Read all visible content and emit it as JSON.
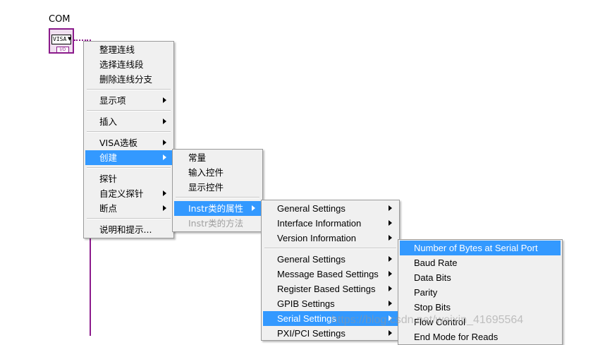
{
  "terminal": {
    "label": "COM",
    "control_text": "VISA",
    "io_text": "I/O"
  },
  "menu1": {
    "items": [
      "整理连线",
      "选择连线段",
      "删除连线分支",
      "显示项",
      "插入",
      "VISA选板",
      "创建",
      "探针",
      "自定义探针",
      "断点",
      "说明和提示..."
    ]
  },
  "menu2": {
    "items": [
      "常量",
      "输入控件",
      "显示控件",
      "Instr类的属性",
      "Instr类的方法"
    ]
  },
  "menu3": {
    "items": [
      "General Settings",
      "Interface Information",
      "Version Information",
      "General Settings",
      "Message Based Settings",
      "Register Based Settings",
      "GPIB Settings",
      "Serial Settings",
      "PXI/PCI Settings"
    ]
  },
  "menu4": {
    "items": [
      "Number of Bytes at Serial Port",
      "Baud Rate",
      "Data Bits",
      "Parity",
      "Stop Bits",
      "Flow Control",
      "End Mode for Reads"
    ]
  },
  "watermark": "https://blog.csdn.net/weixin_41695564",
  "colors": {
    "highlight": "#3399ff",
    "wire": "#8b1a8b",
    "menu_bg": "#f0f0f0"
  }
}
